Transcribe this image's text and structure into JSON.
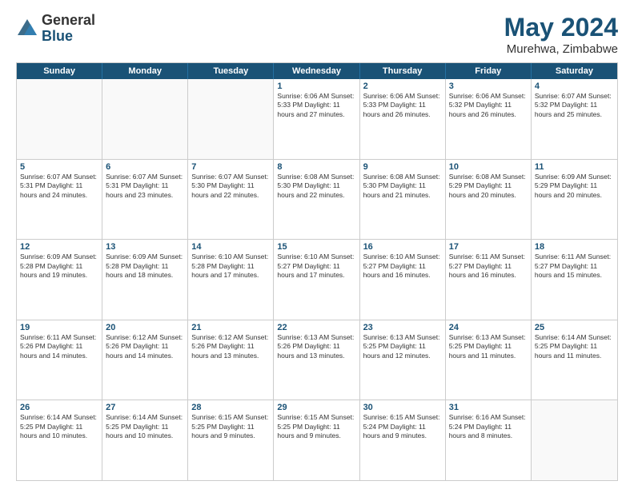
{
  "header": {
    "logo_general": "General",
    "logo_blue": "Blue",
    "title": "May 2024",
    "subtitle": "Murehwa, Zimbabwe"
  },
  "day_headers": [
    "Sunday",
    "Monday",
    "Tuesday",
    "Wednesday",
    "Thursday",
    "Friday",
    "Saturday"
  ],
  "weeks": [
    [
      {
        "day": "",
        "empty": true
      },
      {
        "day": "",
        "empty": true
      },
      {
        "day": "",
        "empty": true
      },
      {
        "day": "1",
        "info": "Sunrise: 6:06 AM\nSunset: 5:33 PM\nDaylight: 11 hours\nand 27 minutes."
      },
      {
        "day": "2",
        "info": "Sunrise: 6:06 AM\nSunset: 5:33 PM\nDaylight: 11 hours\nand 26 minutes."
      },
      {
        "day": "3",
        "info": "Sunrise: 6:06 AM\nSunset: 5:32 PM\nDaylight: 11 hours\nand 26 minutes."
      },
      {
        "day": "4",
        "info": "Sunrise: 6:07 AM\nSunset: 5:32 PM\nDaylight: 11 hours\nand 25 minutes."
      }
    ],
    [
      {
        "day": "5",
        "info": "Sunrise: 6:07 AM\nSunset: 5:31 PM\nDaylight: 11 hours\nand 24 minutes."
      },
      {
        "day": "6",
        "info": "Sunrise: 6:07 AM\nSunset: 5:31 PM\nDaylight: 11 hours\nand 23 minutes."
      },
      {
        "day": "7",
        "info": "Sunrise: 6:07 AM\nSunset: 5:30 PM\nDaylight: 11 hours\nand 22 minutes."
      },
      {
        "day": "8",
        "info": "Sunrise: 6:08 AM\nSunset: 5:30 PM\nDaylight: 11 hours\nand 22 minutes."
      },
      {
        "day": "9",
        "info": "Sunrise: 6:08 AM\nSunset: 5:30 PM\nDaylight: 11 hours\nand 21 minutes."
      },
      {
        "day": "10",
        "info": "Sunrise: 6:08 AM\nSunset: 5:29 PM\nDaylight: 11 hours\nand 20 minutes."
      },
      {
        "day": "11",
        "info": "Sunrise: 6:09 AM\nSunset: 5:29 PM\nDaylight: 11 hours\nand 20 minutes."
      }
    ],
    [
      {
        "day": "12",
        "info": "Sunrise: 6:09 AM\nSunset: 5:28 PM\nDaylight: 11 hours\nand 19 minutes."
      },
      {
        "day": "13",
        "info": "Sunrise: 6:09 AM\nSunset: 5:28 PM\nDaylight: 11 hours\nand 18 minutes."
      },
      {
        "day": "14",
        "info": "Sunrise: 6:10 AM\nSunset: 5:28 PM\nDaylight: 11 hours\nand 17 minutes."
      },
      {
        "day": "15",
        "info": "Sunrise: 6:10 AM\nSunset: 5:27 PM\nDaylight: 11 hours\nand 17 minutes."
      },
      {
        "day": "16",
        "info": "Sunrise: 6:10 AM\nSunset: 5:27 PM\nDaylight: 11 hours\nand 16 minutes."
      },
      {
        "day": "17",
        "info": "Sunrise: 6:11 AM\nSunset: 5:27 PM\nDaylight: 11 hours\nand 16 minutes."
      },
      {
        "day": "18",
        "info": "Sunrise: 6:11 AM\nSunset: 5:27 PM\nDaylight: 11 hours\nand 15 minutes."
      }
    ],
    [
      {
        "day": "19",
        "info": "Sunrise: 6:11 AM\nSunset: 5:26 PM\nDaylight: 11 hours\nand 14 minutes."
      },
      {
        "day": "20",
        "info": "Sunrise: 6:12 AM\nSunset: 5:26 PM\nDaylight: 11 hours\nand 14 minutes."
      },
      {
        "day": "21",
        "info": "Sunrise: 6:12 AM\nSunset: 5:26 PM\nDaylight: 11 hours\nand 13 minutes."
      },
      {
        "day": "22",
        "info": "Sunrise: 6:13 AM\nSunset: 5:26 PM\nDaylight: 11 hours\nand 13 minutes."
      },
      {
        "day": "23",
        "info": "Sunrise: 6:13 AM\nSunset: 5:25 PM\nDaylight: 11 hours\nand 12 minutes."
      },
      {
        "day": "24",
        "info": "Sunrise: 6:13 AM\nSunset: 5:25 PM\nDaylight: 11 hours\nand 11 minutes."
      },
      {
        "day": "25",
        "info": "Sunrise: 6:14 AM\nSunset: 5:25 PM\nDaylight: 11 hours\nand 11 minutes."
      }
    ],
    [
      {
        "day": "26",
        "info": "Sunrise: 6:14 AM\nSunset: 5:25 PM\nDaylight: 11 hours\nand 10 minutes."
      },
      {
        "day": "27",
        "info": "Sunrise: 6:14 AM\nSunset: 5:25 PM\nDaylight: 11 hours\nand 10 minutes."
      },
      {
        "day": "28",
        "info": "Sunrise: 6:15 AM\nSunset: 5:25 PM\nDaylight: 11 hours\nand 9 minutes."
      },
      {
        "day": "29",
        "info": "Sunrise: 6:15 AM\nSunset: 5:25 PM\nDaylight: 11 hours\nand 9 minutes."
      },
      {
        "day": "30",
        "info": "Sunrise: 6:15 AM\nSunset: 5:24 PM\nDaylight: 11 hours\nand 9 minutes."
      },
      {
        "day": "31",
        "info": "Sunrise: 6:16 AM\nSunset: 5:24 PM\nDaylight: 11 hours\nand 8 minutes."
      },
      {
        "day": "",
        "empty": true
      }
    ]
  ]
}
